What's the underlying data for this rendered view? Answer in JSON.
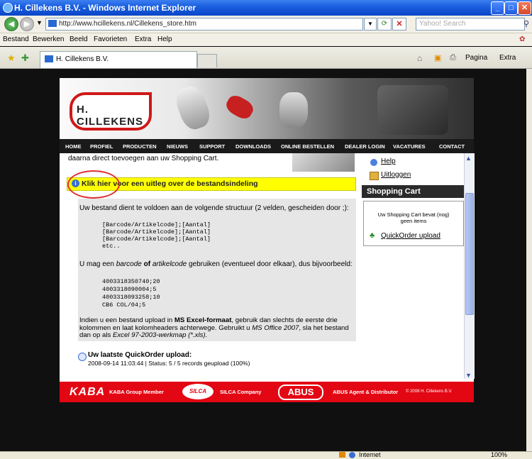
{
  "window": {
    "title": "H. Cillekens B.V. - Windows Internet Explorer"
  },
  "address": {
    "url": "http://www.hcillekens.nl/Cillekens_store.htm",
    "search_placeholder": "Yahoo! Search"
  },
  "menu": [
    "Bestand",
    "Bewerken",
    "Beeld",
    "Favorieten",
    "Extra",
    "Help"
  ],
  "tab": {
    "title": "H. Cillekens B.V."
  },
  "toolbar": {
    "page": "Pagina",
    "extra": "Extra"
  },
  "logo": {
    "text": "H. CILLEKENS"
  },
  "nav": [
    "HOME",
    "PROFIEL",
    "PRODUCTEN",
    "NIEUWS",
    "SUPPORT",
    "DOWNLOADS",
    "ONLINE BESTELLEN",
    "DEALER LOGIN",
    "VACATURES",
    "CONTACT"
  ],
  "main": {
    "intro": "daarna direct toevoegen aan uw Shopping Cart.",
    "link_text": "Klik hier voor een uitleg over de bestandsindeling",
    "structure_text": "Uw bestand dient te voldoen aan de volgende structuur (2 velden, gescheiden door ;):",
    "structure_lines": [
      "[Barcode/Artikelcode];[Aantal]",
      "[Barcode/Artikelcode];[Aantal]",
      "[Barcode/Artikelcode];[Aantal]",
      "etc.."
    ],
    "example_pre": "U mag een",
    "example_barcode": "barcode",
    "example_of": "of",
    "example_artikel": "artikelcode",
    "example_post": "gebruiken (eventueel door elkaar), dus bijvoorbeeld:",
    "example_lines": [
      "4003318350740;20",
      "4003318090004;5",
      "4003318093258;10",
      "CB6 COL/04;5"
    ],
    "excel_1": "Indien u een bestand upload in",
    "excel_bold": "MS Excel-formaat",
    "excel_2": ", gebruik dan slechts de eerste drie",
    "excel_line2": "kolommen en laat kolomheaders achterwege. Gebruikt u",
    "excel_office": "MS Office 2007",
    "excel_line2b": ", sla het bestand",
    "excel_line3a": "dan op als",
    "excel_line3b": "Excel 97-2003-werkmap (*.xls).",
    "last_upload_title": "Uw laatste QuickOrder upload:",
    "last_upload_info": "2008-09-14 11:03:44 | Status: 5 / 5 records geupload (100%)"
  },
  "side": {
    "help": "Help",
    "logout": "Uitloggen",
    "cart_title": "Shopping Cart",
    "cart_msg1": "Uw Shopping Cart bevat (nog)",
    "cart_msg2": "geen items",
    "quickorder": "QuickOrder upload"
  },
  "footer": {
    "kaba": "KABA",
    "kaba_text": "KABA Group Member",
    "silca": "SILCA",
    "silca_text": "SILCA Company",
    "abus": "ABUS",
    "abus_text": "ABUS Agent & Distributor",
    "copyright": "© 2008 H. Cillekens B.V."
  },
  "status": {
    "zone": "Internet",
    "zoom": "100%"
  },
  "colors": {
    "footer_red": "#e30613",
    "nav_bg": "#1a1a1a",
    "highlight": "#ffff00"
  }
}
